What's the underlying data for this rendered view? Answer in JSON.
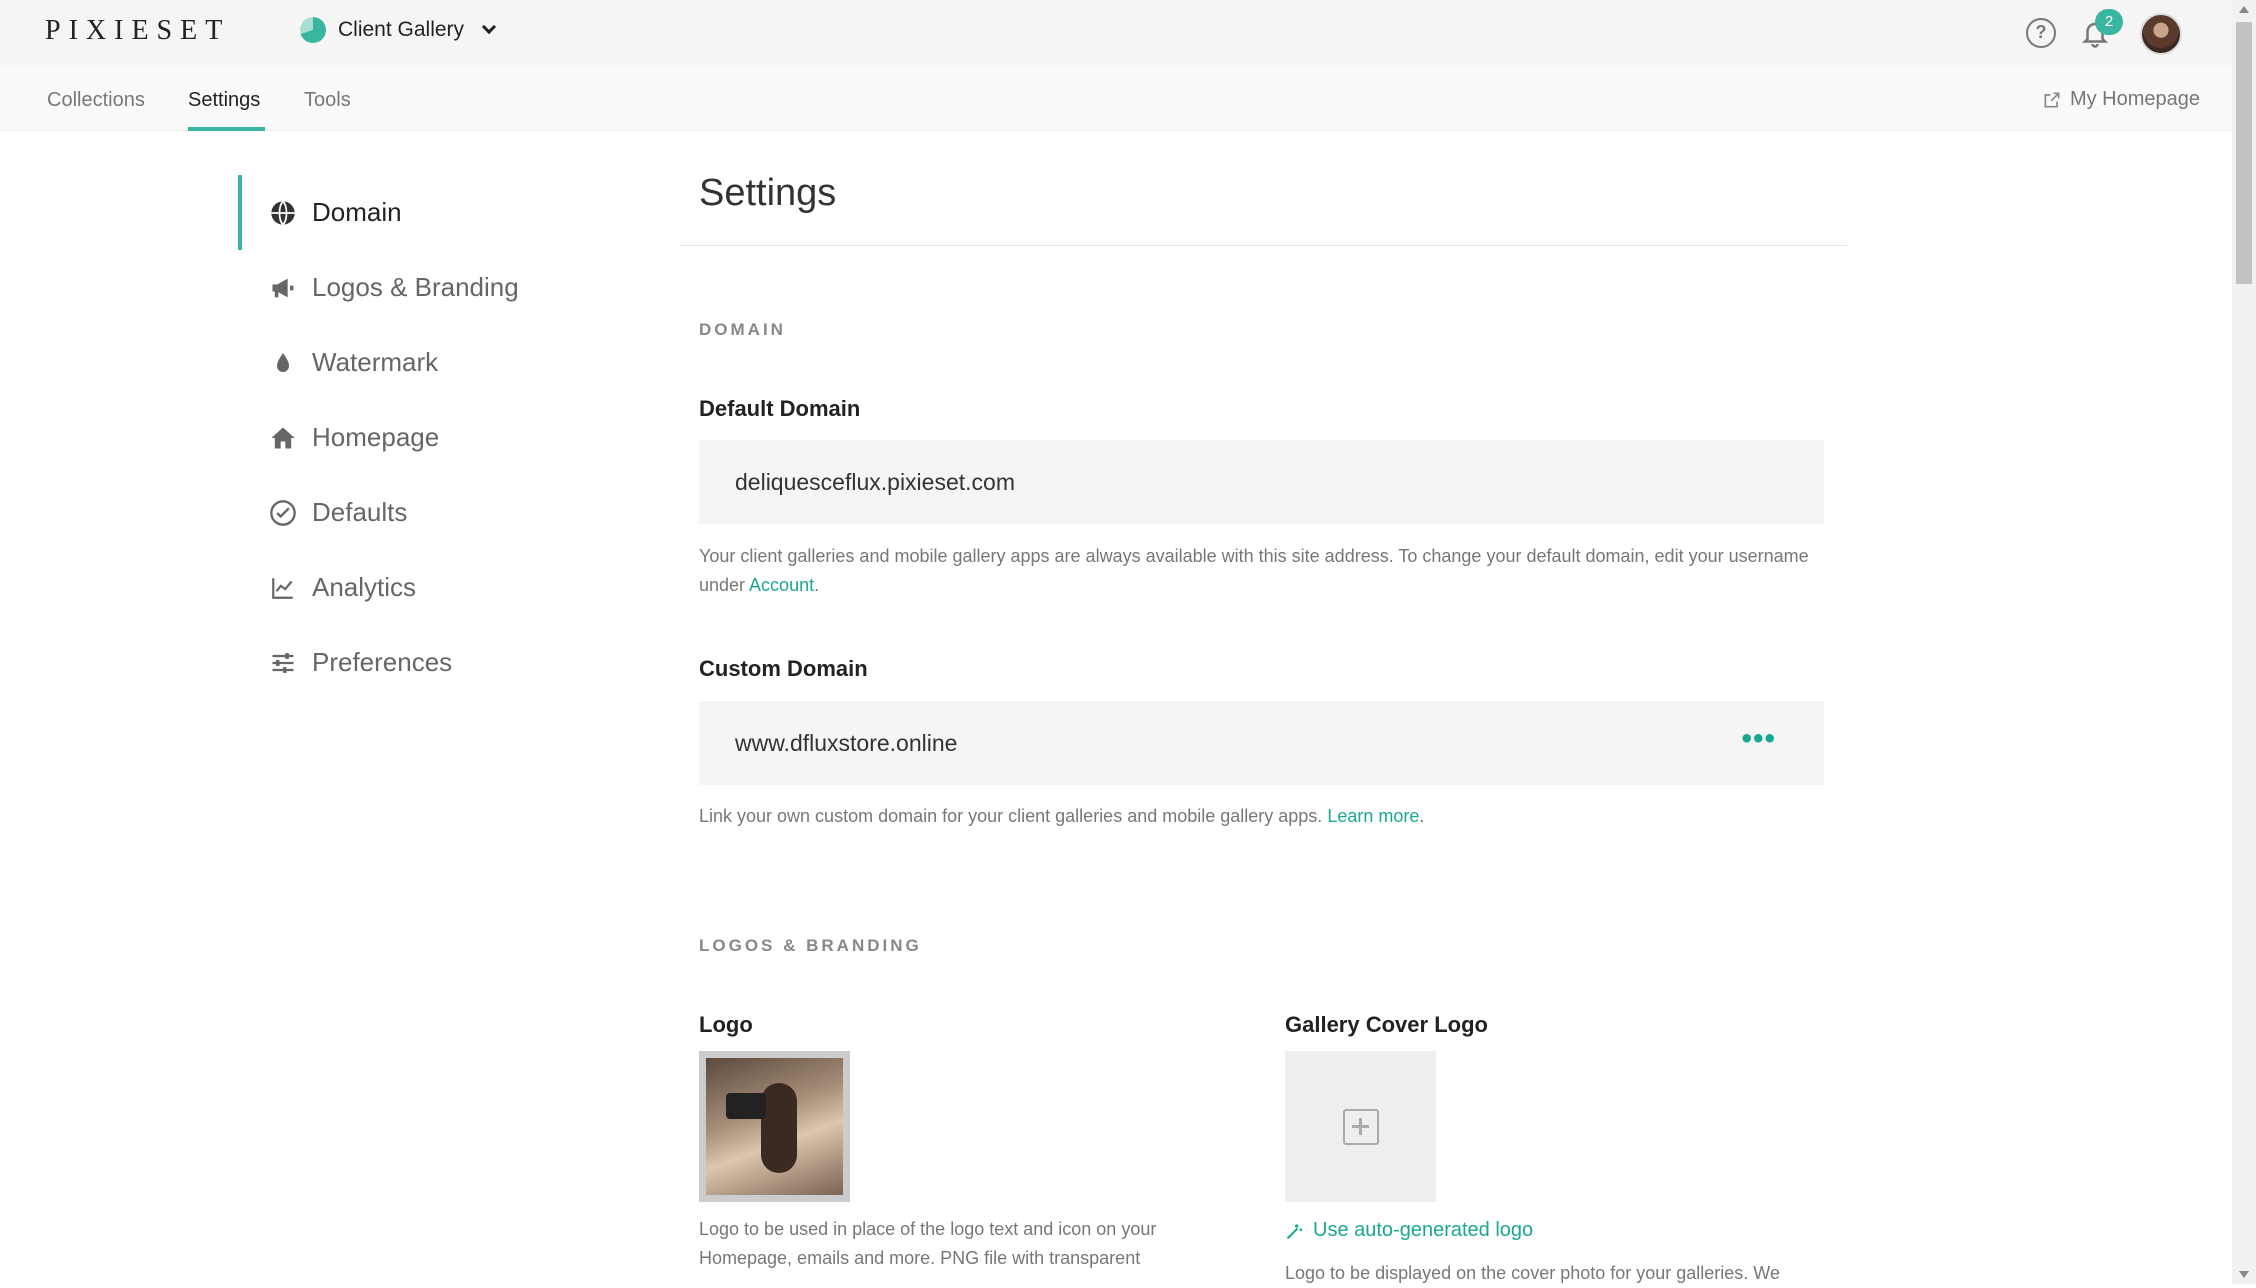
{
  "brand": "PIXIESET",
  "app_switcher": {
    "label": "Client Gallery",
    "icon": "client-gallery-icon"
  },
  "top_icons": {
    "help": "help-icon",
    "notifications": "bell-icon",
    "notification_count": "2"
  },
  "subnav": {
    "tabs": [
      "Collections",
      "Settings",
      "Tools"
    ],
    "active": "Settings",
    "my_homepage": "My Homepage"
  },
  "sidebar": {
    "items": [
      {
        "label": "Domain",
        "icon": "globe-icon",
        "active": true
      },
      {
        "label": "Logos & Branding",
        "icon": "megaphone-icon"
      },
      {
        "label": "Watermark",
        "icon": "drop-icon"
      },
      {
        "label": "Homepage",
        "icon": "home-icon"
      },
      {
        "label": "Defaults",
        "icon": "check-circle-icon"
      },
      {
        "label": "Analytics",
        "icon": "chart-line-icon"
      },
      {
        "label": "Preferences",
        "icon": "sliders-icon"
      }
    ]
  },
  "main": {
    "title": "Settings",
    "domain_section": {
      "heading": "DOMAIN",
      "default_label": "Default Domain",
      "default_value": "deliquesceflux.pixieset.com",
      "default_help_1": "Your client galleries and mobile gallery apps are always available with this site address. To change your default domain, edit your username under ",
      "default_help_link": "Account",
      "default_help_2": ".",
      "custom_label": "Custom Domain",
      "custom_value": "www.dfluxstore.online",
      "custom_menu": "•••",
      "custom_help_1": "Link your own custom domain for your client galleries and mobile gallery apps. ",
      "custom_help_link": "Learn more",
      "custom_help_2": "."
    },
    "branding_section": {
      "heading": "LOGOS & BRANDING",
      "logo_label": "Logo",
      "logo_help": "Logo to be used in place of the logo text and icon on your Homepage, emails and more. PNG file with transparent",
      "cover_label": "Gallery Cover Logo",
      "autogen_link": "Use auto-generated logo",
      "cover_help": "Logo to be displayed on the cover photo for your galleries. We"
    }
  },
  "colors": {
    "accent": "#3ab5a0",
    "link": "#1aa892"
  }
}
